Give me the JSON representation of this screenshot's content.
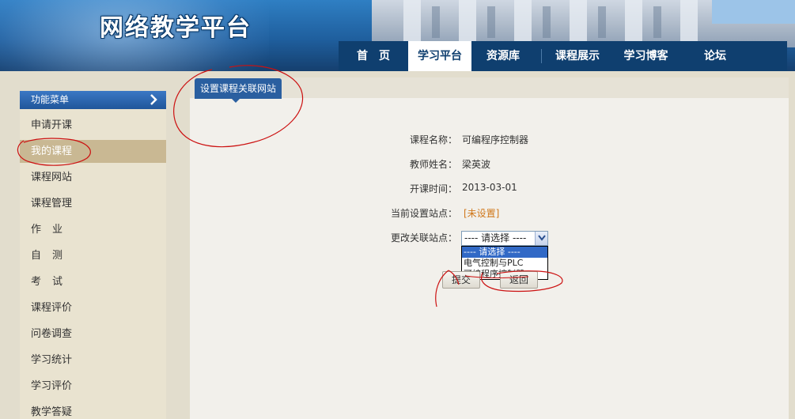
{
  "header": {
    "title": "网络教学平台",
    "nav": [
      {
        "label": "首　页",
        "active": false
      },
      {
        "label": "学习平台",
        "active": true
      },
      {
        "label": "资源库",
        "active": false
      },
      {
        "label": "课程展示",
        "active": false
      },
      {
        "label": "学习博客",
        "active": false
      },
      {
        "label": "论坛",
        "active": false
      }
    ]
  },
  "sidebar": {
    "header": "功能菜单",
    "items": [
      {
        "label": "申请开课",
        "active": false
      },
      {
        "label": "我的课程",
        "active": true
      },
      {
        "label": "课程网站",
        "active": false
      },
      {
        "label": "课程管理",
        "active": false
      },
      {
        "label": "作业",
        "active": false
      },
      {
        "label": "自测",
        "active": false
      },
      {
        "label": "考试",
        "active": false
      },
      {
        "label": "课程评价",
        "active": false
      },
      {
        "label": "问卷调查",
        "active": false
      },
      {
        "label": "学习统计",
        "active": false
      },
      {
        "label": "学习评价",
        "active": false
      },
      {
        "label": "教学答疑",
        "active": false
      }
    ]
  },
  "main": {
    "tab_label": "设置课程关联网站",
    "form": {
      "course_name_label": "课程名称：",
      "course_name": "可编程序控制器",
      "teacher_label": "教师姓名：",
      "teacher": "梁英波",
      "start_time_label": "开课时间：",
      "start_time": "2013-03-01",
      "current_site_label": "当前设置站点：",
      "current_site": "[未设置]",
      "change_site_label": "更改关联站点：",
      "select_value": "---- 请选择 ----",
      "options": [
        "---- 请选择 ----",
        "电气控制与PLC",
        "可编程序控制器"
      ],
      "submit_label": "提交",
      "back_label": "返回"
    }
  },
  "colors": {
    "nav_bg": "#0f3f6f",
    "tab_blue": "#2a5fa0",
    "active_menu": "#c9b893",
    "annotation_red": "#cc1111"
  }
}
